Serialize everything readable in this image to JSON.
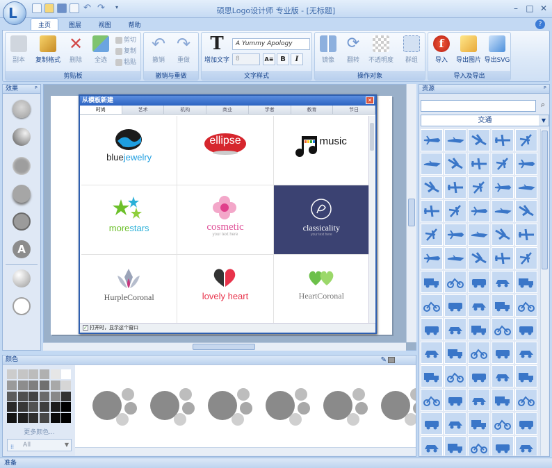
{
  "window": {
    "title": "硕思Logo设计师 专业版 - [无标题]"
  },
  "tabs": [
    {
      "label": "主页",
      "active": true
    },
    {
      "label": "图层",
      "active": false
    },
    {
      "label": "视图",
      "active": false
    },
    {
      "label": "帮助",
      "active": false
    }
  ],
  "ribbon": {
    "clipboard": {
      "label": "剪贴板",
      "copy": "副本",
      "format_painter": "复制格式",
      "delete": "删除",
      "select_all": "全选",
      "cut": "剪切",
      "copy_small": "复制",
      "paste": "粘贴"
    },
    "undo_group": {
      "label": "撤销与重做",
      "undo": "撤销",
      "redo": "重做"
    },
    "text_group": {
      "label": "文字样式",
      "add_text": "增加文字",
      "font_value": "A Yummy Apology",
      "size_value": "8"
    },
    "ops_group": {
      "label": "操作对象",
      "mirror": "镜像",
      "rotate": "翻转",
      "opacity": "不透明度",
      "group": "群组"
    },
    "io_group": {
      "label": "导入及导出",
      "import": "导入",
      "export_image": "导出图片",
      "export_svg": "导出SVG"
    }
  },
  "effects_panel": {
    "title": "效果",
    "pin": "ᵖ"
  },
  "resources_panel": {
    "title": "资源",
    "category": "交通",
    "pin": "ᵖ"
  },
  "color_panel": {
    "title": "颜色",
    "more_colors": "更多颜色...",
    "filter": "All"
  },
  "dialog": {
    "title": "从模板新建",
    "tabs": [
      "时尚",
      "艺术",
      "机构",
      "商业",
      "学者",
      "教育",
      "节日"
    ],
    "templates": [
      {
        "name": "bluejewelry",
        "word1": "blue",
        "word2": "jewelry"
      },
      {
        "name": "ellipse"
      },
      {
        "name": "music"
      },
      {
        "name": "morestars",
        "word1": "more",
        "word2": "stars"
      },
      {
        "name": "cosmetic",
        "tagline": "your text here"
      },
      {
        "name": "classicality",
        "tagline": "your text here"
      },
      {
        "name": "HurpleCoronal"
      },
      {
        "name": "lovely heart"
      },
      {
        "name": "HeartCoronal"
      }
    ],
    "checkbox_label": "打开时，显示这个窗口",
    "checkbox_checked": true
  },
  "colors": {
    "swatches": [
      "#cccccc",
      "#c5c5c5",
      "#bcbcbc",
      "#b0b0b0",
      "#e6e6e6",
      "#ffffff",
      "#9a9a9a",
      "#8d8d8d",
      "#7f7f7f",
      "#707070",
      "#a8a8a8",
      "#d6d6d6",
      "#5c5c5c",
      "#4f4f4f",
      "#434343",
      "#6b6b6b",
      "#888888",
      "#333333",
      "#2a2a2a",
      "#383838",
      "#525252",
      "#3e3e3e",
      "#1c1c1c",
      "#000000",
      "#141414",
      "#1f1f1f",
      "#2f2f2f",
      "#474747",
      "#0a0a0a",
      "#000000"
    ],
    "accent": "#3a76c8"
  },
  "status": {
    "text": "准备"
  }
}
